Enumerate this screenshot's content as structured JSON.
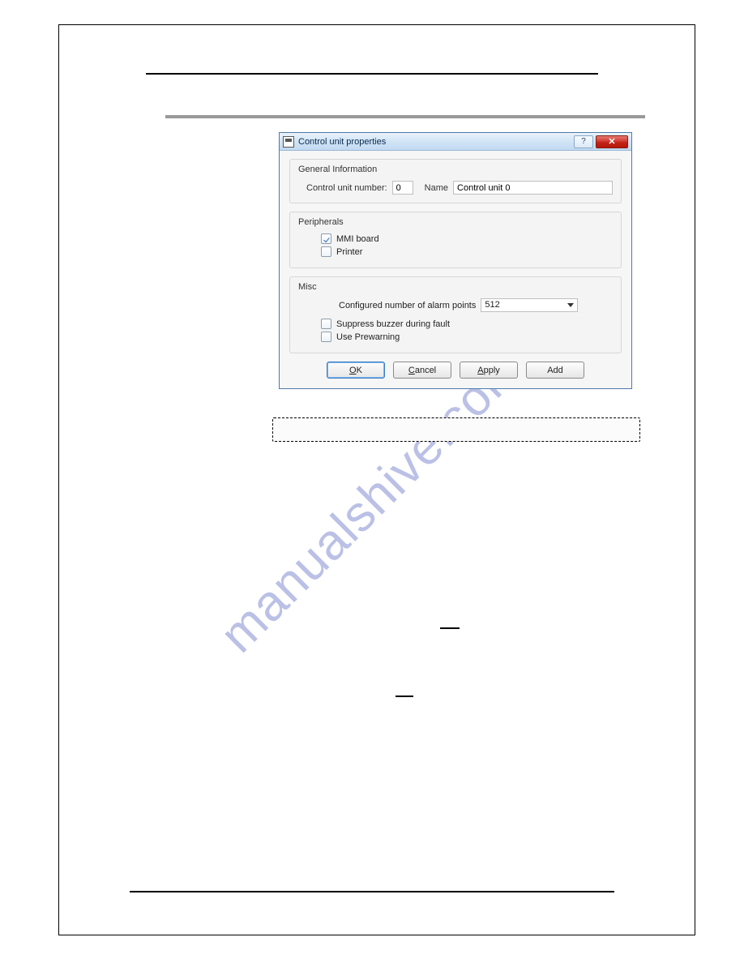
{
  "watermark": "manualshive.com",
  "dialog": {
    "title": "Control unit properties",
    "general": {
      "legend": "General Information",
      "unit_label": "Control unit number:",
      "unit_value": "0",
      "name_label": "Name",
      "name_value": "Control unit 0"
    },
    "peripherals": {
      "legend": "Peripherals",
      "items": [
        {
          "label": "MMI board",
          "checked": true
        },
        {
          "label": "Printer",
          "checked": false
        }
      ]
    },
    "misc": {
      "legend": "Misc",
      "alarm_label": "Configured number of alarm points",
      "alarm_value": "512",
      "items": [
        {
          "label": "Suppress buzzer during fault",
          "checked": false
        },
        {
          "label_prefix": "Use ",
          "label_ul": "P",
          "label_suffix": "rewarning",
          "checked": false
        }
      ]
    },
    "buttons": {
      "ok_ul": "O",
      "ok_rest": "K",
      "cancel_ul": "C",
      "cancel_rest": "ancel",
      "apply_ul": "A",
      "apply_rest": "pply",
      "add": "Add"
    }
  }
}
